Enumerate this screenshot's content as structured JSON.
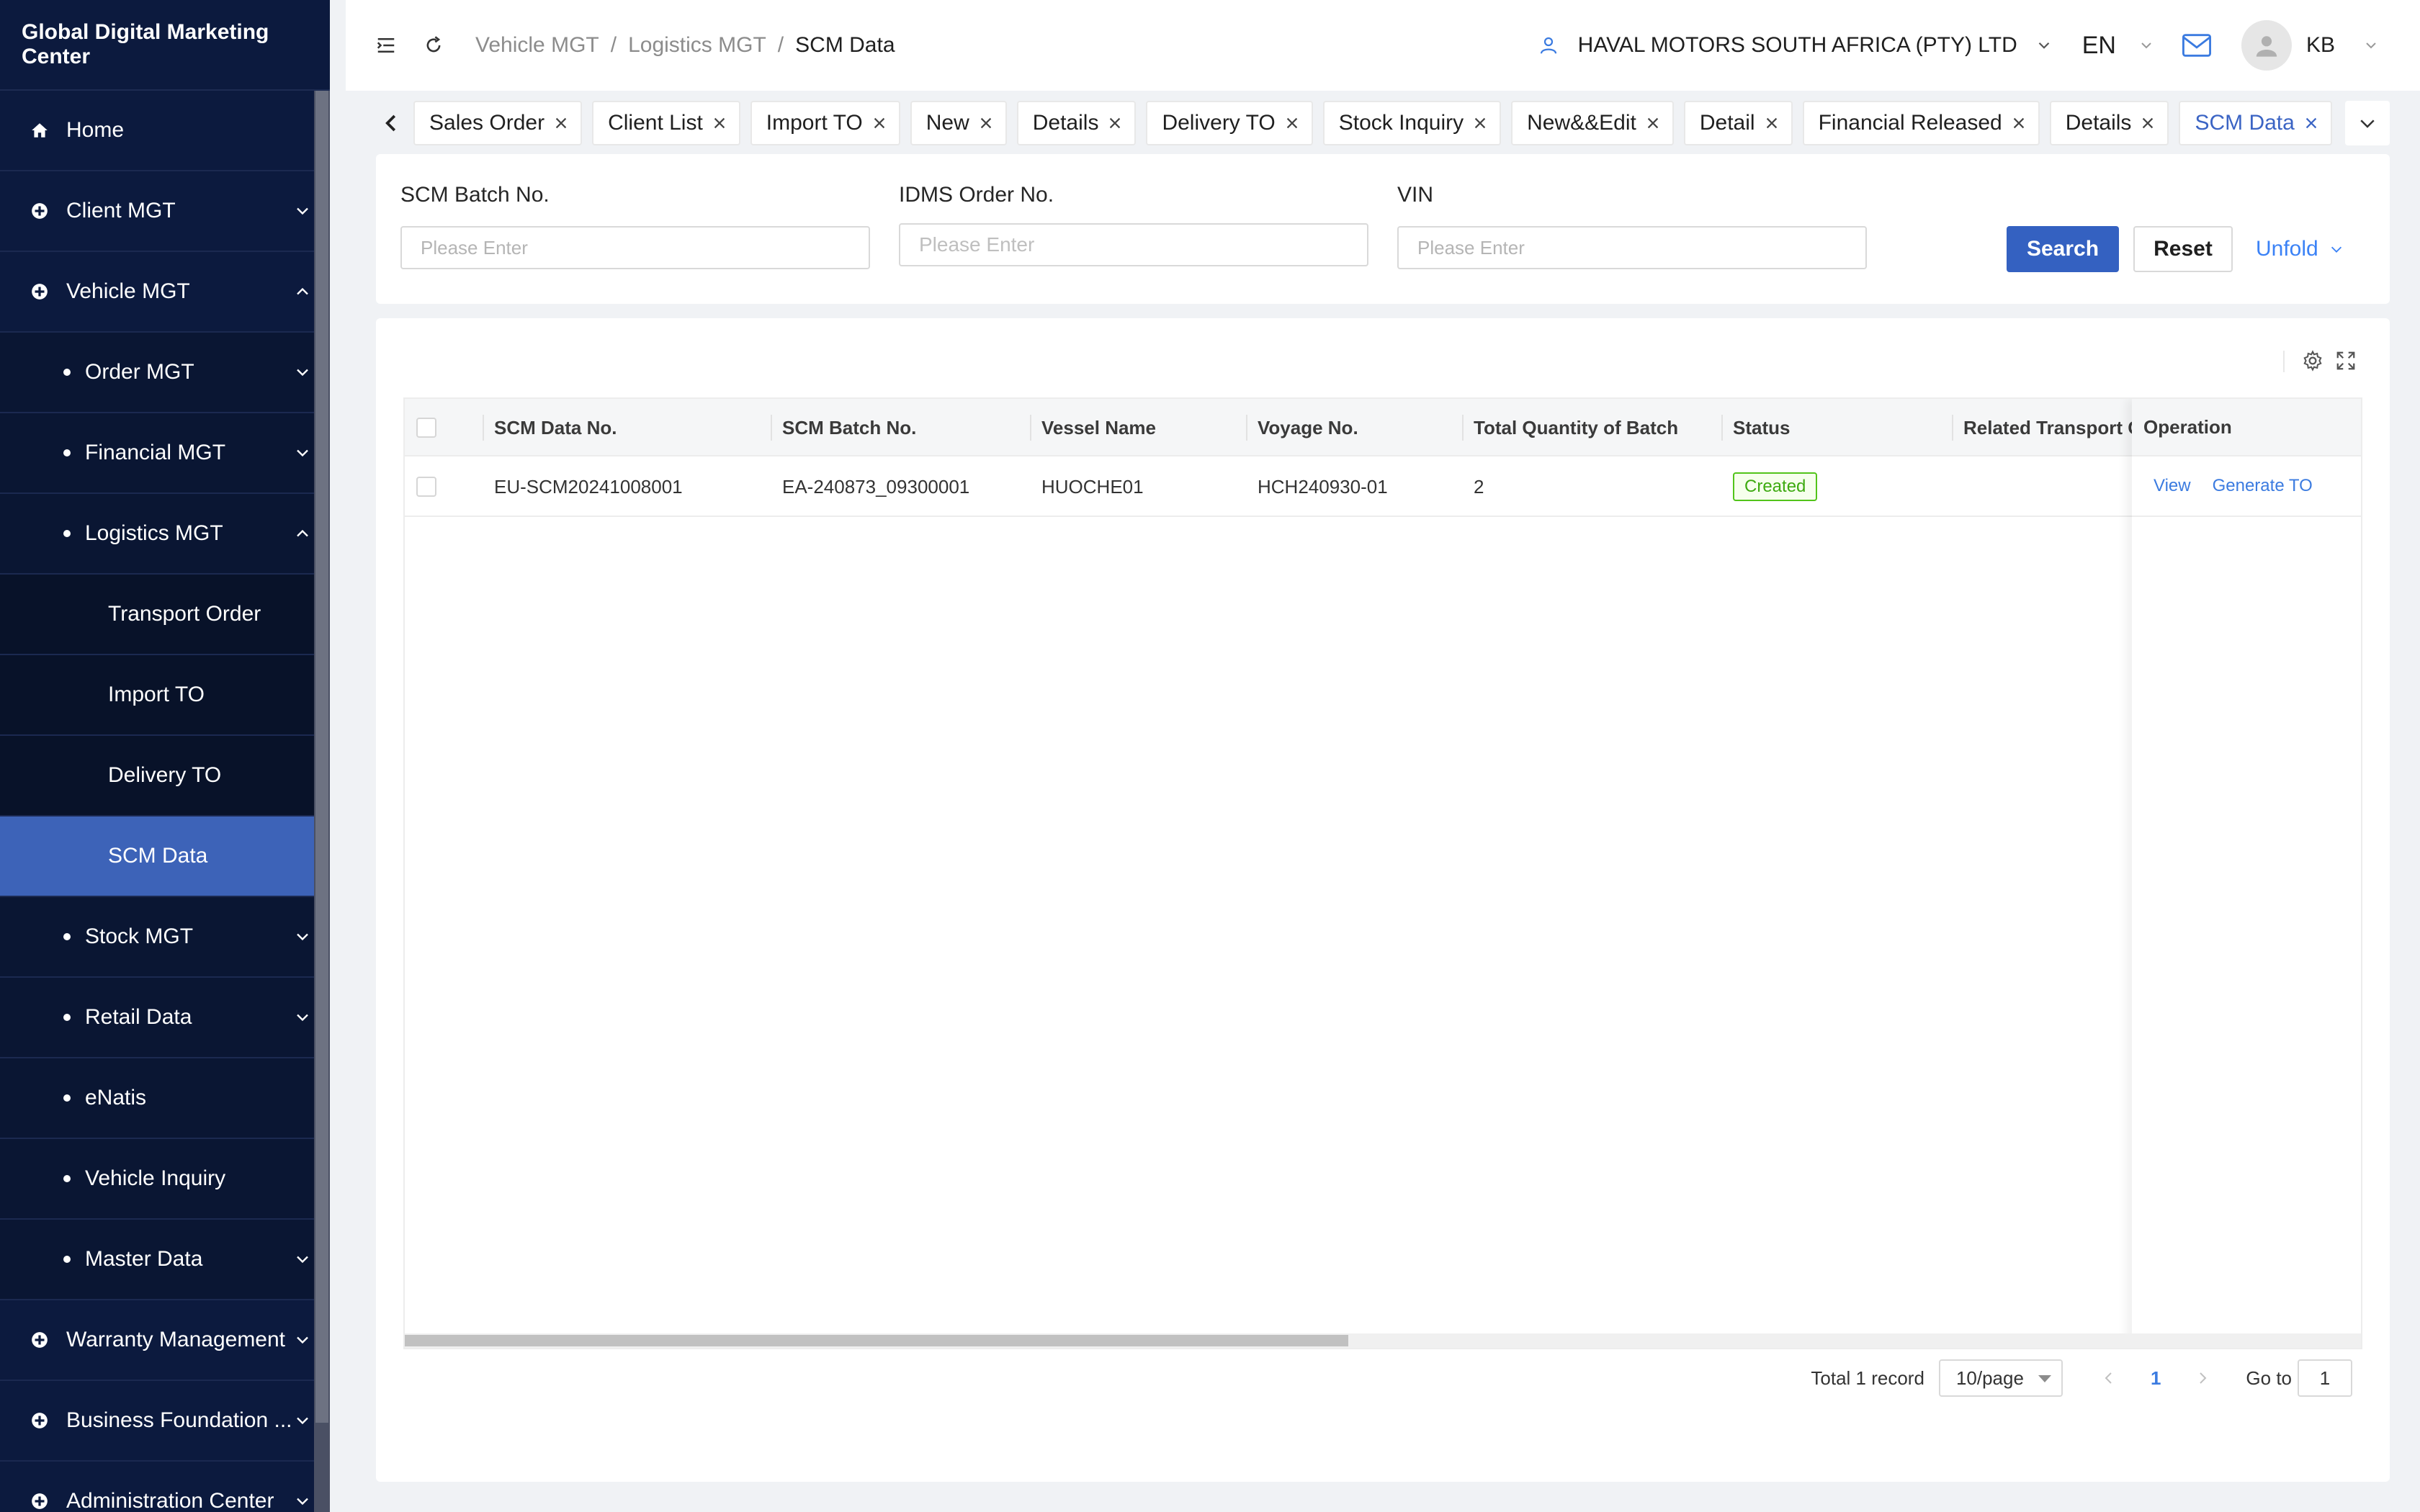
{
  "app": {
    "title": "Global Digital Marketing Center"
  },
  "sidebar": {
    "items": [
      {
        "label": "Home",
        "level": 1,
        "icon": "home-icon"
      },
      {
        "label": "Client MGT",
        "level": 1,
        "icon": "module-icon",
        "chevron": "down"
      },
      {
        "label": "Vehicle MGT",
        "level": 1,
        "icon": "module-icon",
        "chevron": "up"
      },
      {
        "label": "Order MGT",
        "level": 2,
        "chevron": "down"
      },
      {
        "label": "Financial MGT",
        "level": 2,
        "chevron": "down"
      },
      {
        "label": "Logistics MGT",
        "level": 2,
        "chevron": "up"
      },
      {
        "label": "Transport Order",
        "level": 3
      },
      {
        "label": "Import TO",
        "level": 3
      },
      {
        "label": "Delivery TO",
        "level": 3
      },
      {
        "label": "SCM Data",
        "level": 3,
        "active": true
      },
      {
        "label": "Stock MGT",
        "level": 2,
        "chevron": "down"
      },
      {
        "label": "Retail Data",
        "level": 2,
        "chevron": "down"
      },
      {
        "label": "eNatis",
        "level": 2
      },
      {
        "label": "Vehicle Inquiry",
        "level": 2
      },
      {
        "label": "Master Data",
        "level": 2,
        "chevron": "down"
      },
      {
        "label": "Warranty Management",
        "level": 1,
        "icon": "module-icon",
        "chevron": "down"
      },
      {
        "label": "Business Foundation ...",
        "level": 1,
        "icon": "module-icon",
        "chevron": "down"
      },
      {
        "label": "Administration Center",
        "level": 1,
        "icon": "module-icon",
        "chevron": "down"
      }
    ]
  },
  "header": {
    "breadcrumb": [
      "Vehicle MGT",
      "Logistics MGT",
      "SCM Data"
    ],
    "company": "HAVAL MOTORS SOUTH AFRICA (PTY) LTD",
    "language": "EN",
    "user": "KB"
  },
  "tabs": [
    "Sales Order",
    "Client List",
    "Import TO",
    "New",
    "Details",
    "Delivery TO",
    "Stock Inquiry",
    "New&&Edit",
    "Detail",
    "Financial Released",
    "Details",
    "SCM Data"
  ],
  "active_tab": "SCM Data",
  "filters": {
    "batch_no": {
      "label": "SCM Batch No.",
      "placeholder": "Please Enter"
    },
    "idms_order": {
      "label": "IDMS Order No.",
      "placeholder": "Please Enter"
    },
    "vin": {
      "label": "VIN",
      "placeholder": "Please Enter"
    },
    "search_label": "Search",
    "reset_label": "Reset",
    "unfold_label": "Unfold"
  },
  "table": {
    "columns": [
      "SCM Data No.",
      "SCM Batch No.",
      "Vessel Name",
      "Voyage No.",
      "Total Quantity of Batch",
      "Status",
      "Related Transport Order"
    ],
    "operation_header": "Operation",
    "rows": [
      {
        "scm_data_no": "EU-SCM20241008001",
        "scm_batch_no": "EA-240873_09300001",
        "vessel_name": "HUOCHE01",
        "voyage_no": "HCH240930-01",
        "total_quantity": "2",
        "status": "Created",
        "related_to": "",
        "actions": [
          "View",
          "Generate TO"
        ]
      }
    ]
  },
  "pagination": {
    "total": "Total 1 record",
    "page_size": "10/page",
    "current_page": "1",
    "goto_label": "Go to",
    "goto_value": "1"
  },
  "colors": {
    "sidebar_bg": "#0c1a3e",
    "active": "#3d63b8",
    "primary": "#3461c1",
    "link": "#3b7be0",
    "status_ok": "#52c41a"
  }
}
